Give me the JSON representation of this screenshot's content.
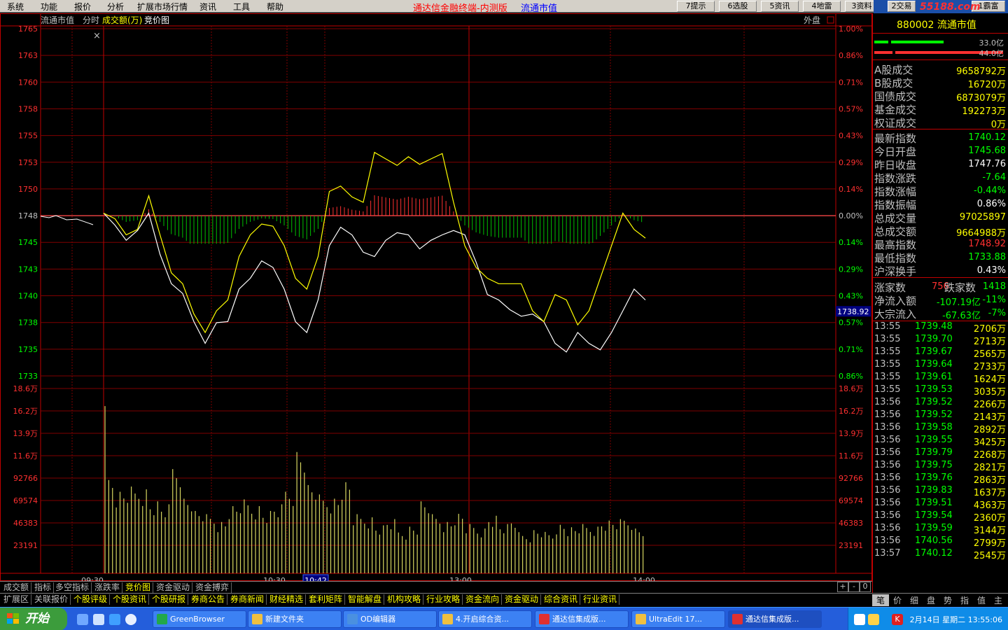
{
  "menu": [
    "系统",
    "功能",
    "报价",
    "分析",
    "扩展市场行情",
    "资讯",
    "工具",
    "帮助"
  ],
  "app_title": "通达信金融终端-内测版",
  "app_subtitle": "流通市值",
  "toolbar_buttons": [
    "7提示",
    "6选股",
    "5资讯",
    "4地雷",
    "3资料",
    "2交易",
    "1霸富"
  ],
  "logo_text": "55188.com",
  "chart_header": {
    "name": "流通市值",
    "items": [
      "分时",
      "成交额(万)",
      "竞价图"
    ],
    "right_label": "外盘"
  },
  "chart_data": {
    "type": "line",
    "prev_close": 1747.76,
    "price_axis_labels": [
      "1765",
      "1763",
      "1760",
      "1758",
      "1755",
      "1753",
      "1750",
      "1748",
      "1745",
      "1743",
      "1740",
      "1738",
      "1735",
      "1733"
    ],
    "pct_axis_labels": [
      "1.00%",
      "0.86%",
      "0.71%",
      "0.57%",
      "0.43%",
      "0.29%",
      "0.14%",
      "0.00%",
      "0.14%",
      "0.29%",
      "0.43%",
      "0.57%",
      "0.71%",
      "0.86%"
    ],
    "volume_axis_labels": [
      "18.6万",
      "16.2万",
      "13.9万",
      "11.6万",
      "92766",
      "69574",
      "46383",
      "23191"
    ],
    "time_labels": [
      "09:30",
      "10:30",
      "10:42",
      "13:00",
      "14:00"
    ],
    "current_price_label": "1738.92",
    "ylim": [
      1732,
      1766
    ],
    "volume_ylim": [
      0,
      210000
    ],
    "series": [
      {
        "color": "#ffffff",
        "x": [
          0,
          5,
          10,
          15,
          20,
          25,
          30,
          35,
          40,
          45,
          50,
          55,
          60,
          65,
          70,
          75,
          80,
          85,
          90,
          95,
          100,
          105,
          110,
          115,
          120,
          125,
          130,
          135,
          140,
          145,
          150,
          155,
          160,
          165,
          170,
          175,
          180,
          185,
          190,
          195,
          200,
          205,
          210,
          215,
          220,
          225,
          230,
          235,
          240
        ],
        "values": [
          1748.0,
          1746.9,
          1745.5,
          1746.4,
          1748.0,
          1744.2,
          1741.5,
          1740.6,
          1738.0,
          1736.0,
          1737.9,
          1738.0,
          1741.0,
          1742.0,
          1743.6,
          1743.0,
          1741.0,
          1738.0,
          1737.0,
          1740.0,
          1745.0,
          1746.7,
          1746.0,
          1744.4,
          1744.0,
          1745.5,
          1746.2,
          1746.0,
          1744.7,
          1745.5,
          1746.0,
          1746.4,
          1746.0,
          1743.5,
          1740.5,
          1740.0,
          1739.1,
          1738.5,
          1738.7,
          1738.0,
          1736.0,
          1735.2,
          1737.0,
          1736.0,
          1735.4,
          1737.0,
          1739.0,
          1741.0,
          1740.0
        ]
      },
      {
        "color": "#ffff00",
        "x": [
          0,
          5,
          10,
          15,
          20,
          25,
          30,
          35,
          40,
          45,
          50,
          55,
          60,
          65,
          70,
          75,
          80,
          85,
          90,
          95,
          100,
          105,
          110,
          115,
          120,
          125,
          130,
          135,
          140,
          145,
          150,
          155,
          160,
          165,
          170,
          175,
          180,
          185,
          190,
          195,
          200,
          205,
          210,
          215,
          220,
          225,
          230,
          235,
          240
        ],
        "values": [
          1748.0,
          1747.5,
          1746.0,
          1746.5,
          1749.6,
          1746.0,
          1742.5,
          1741.5,
          1738.7,
          1737.0,
          1739.0,
          1740.0,
          1744.0,
          1746.0,
          1747.0,
          1746.8,
          1745.0,
          1742.0,
          1741.0,
          1744.0,
          1750.0,
          1750.5,
          1749.5,
          1749.0,
          1753.6,
          1753.0,
          1752.4,
          1753.2,
          1752.5,
          1753.0,
          1753.5,
          1749.0,
          1745.0,
          1743.0,
          1742.0,
          1741.5,
          1741.5,
          1741.5,
          1739.0,
          1738.0,
          1740.5,
          1740.0,
          1737.7,
          1739.0,
          1742.0,
          1745.0,
          1748.0,
          1746.5,
          1745.7
        ]
      }
    ],
    "bar_values": [
      100000,
      85000,
      88000,
      90000,
      75000,
      70000,
      115000,
      80000,
      65000,
      60000,
      55000,
      70000,
      75000,
      72000,
      65000,
      70000,
      90000,
      130000,
      92000,
      80000,
      80000,
      95000,
      60000,
      60000,
      50000,
      55000,
      45000,
      50000,
      75000,
      60000,
      55000,
      62000,
      50000,
      48000,
      60000,
      50000,
      55000,
      40000,
      45000,
      42000,
      52000,
      48000,
      50000,
      50000,
      55000,
      55000,
      58000,
      48000,
      40000
    ]
  },
  "info": {
    "code": "880002",
    "name": "流通市值",
    "bar1_label": "33.0亿",
    "bar2_label": "44.0亿",
    "rows1": [
      {
        "k": "A股成交",
        "v": "9658792万",
        "c": "#ffff00"
      },
      {
        "k": "B股成交",
        "v": "16720万",
        "c": "#ffff00"
      },
      {
        "k": "国债成交",
        "v": "6873079万",
        "c": "#ffff00"
      },
      {
        "k": "基金成交",
        "v": "192273万",
        "c": "#ffff00"
      },
      {
        "k": "权证成交",
        "v": "0万",
        "c": "#ffff00"
      }
    ],
    "rows2": [
      {
        "k": "最新指数",
        "v": "1740.12",
        "c": "#00ff00"
      },
      {
        "k": "今日开盘",
        "v": "1745.68",
        "c": "#00ff00"
      },
      {
        "k": "昨日收盘",
        "v": "1747.76",
        "c": "#ffffff"
      },
      {
        "k": "指数涨跌",
        "v": "-7.64",
        "c": "#00ff00"
      },
      {
        "k": "指数涨幅",
        "v": "-0.44%",
        "c": "#00ff00"
      },
      {
        "k": "指数振幅",
        "v": "0.86%",
        "c": "#ffffff"
      },
      {
        "k": "总成交量",
        "v": "97025897",
        "c": "#ffff00"
      },
      {
        "k": "总成交额",
        "v": "9664988万",
        "c": "#ffff00"
      },
      {
        "k": "最高指数",
        "v": "1748.92",
        "c": "#ff3030"
      },
      {
        "k": "最低指数",
        "v": "1733.88",
        "c": "#00ff00"
      },
      {
        "k": "沪深换手",
        "v": "0.43%",
        "c": "#ffffff"
      }
    ],
    "up_label": "涨家数",
    "up_value": "756",
    "down_label": "跌家数",
    "down_value": "1418",
    "net_in_label": "净流入额",
    "net_in_value": "-107.19亿",
    "net_in_pct": "-11%",
    "big_in_label": "大宗流入",
    "big_in_value": "-67.63亿",
    "big_in_pct": "-7%",
    "ticks": [
      {
        "t": "13:55",
        "p": "1739.48",
        "q": "2706万"
      },
      {
        "t": "13:55",
        "p": "1739.70",
        "q": "2713万"
      },
      {
        "t": "13:55",
        "p": "1739.67",
        "q": "2565万"
      },
      {
        "t": "13:55",
        "p": "1739.64",
        "q": "2733万"
      },
      {
        "t": "13:55",
        "p": "1739.61",
        "q": "1624万"
      },
      {
        "t": "13:55",
        "p": "1739.53",
        "q": "3035万"
      },
      {
        "t": "13:56",
        "p": "1739.52",
        "q": "2266万"
      },
      {
        "t": "13:56",
        "p": "1739.52",
        "q": "2143万"
      },
      {
        "t": "13:56",
        "p": "1739.58",
        "q": "2892万"
      },
      {
        "t": "13:56",
        "p": "1739.55",
        "q": "3425万"
      },
      {
        "t": "13:56",
        "p": "1739.79",
        "q": "2268万"
      },
      {
        "t": "13:56",
        "p": "1739.75",
        "q": "2821万"
      },
      {
        "t": "13:56",
        "p": "1739.76",
        "q": "2863万"
      },
      {
        "t": "13:56",
        "p": "1739.83",
        "q": "1637万"
      },
      {
        "t": "13:56",
        "p": "1739.51",
        "q": "4363万"
      },
      {
        "t": "13:56",
        "p": "1739.54",
        "q": "2360万"
      },
      {
        "t": "13:56",
        "p": "1739.59",
        "q": "3144万"
      },
      {
        "t": "13:56",
        "p": "1740.56",
        "q": "2799万"
      },
      {
        "t": "13:57",
        "p": "1740.12",
        "q": "2545万"
      }
    ]
  },
  "tabs1": [
    "成交额",
    "指标",
    "多空指标",
    "涨跌率",
    "竞价图",
    "资金驱动",
    "资金搏弈"
  ],
  "tabs1_active": 4,
  "tabs2": [
    "扩展区",
    "关联报价",
    "个股评级",
    "个股资讯",
    "个股研报",
    "券商公告",
    "券商新闻",
    "财经精选",
    "套利矩阵",
    "智能解盘",
    "机构攻略",
    "行业攻略",
    "资金流向",
    "资金驱动",
    "综合资讯",
    "行业资讯"
  ],
  "rtabs": [
    "笔",
    "价",
    "细",
    "盘",
    "势",
    "指",
    "值",
    "主"
  ],
  "zoom": {
    "plus": "+",
    "minus": "-",
    "zero": "0"
  },
  "taskbar": {
    "start": "开始",
    "tasks": [
      "GreenBrowser",
      "新建文件夹",
      "OD编辑器",
      "4.开启综合资...",
      "通达信集成版...",
      "UltraEdit 17...",
      "通达信集成版..."
    ],
    "clock": "2月14日 星期二 13:55:06"
  }
}
